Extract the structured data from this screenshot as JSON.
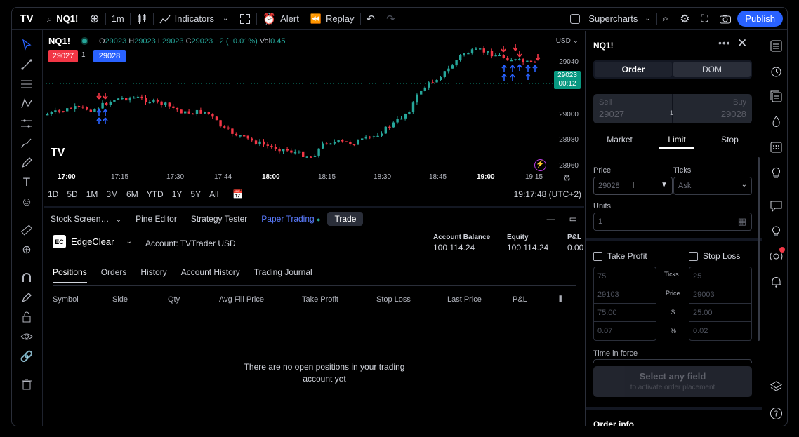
{
  "topbar": {
    "logo": "TV",
    "symbol": "NQ1!",
    "interval": "1m",
    "indicators_label": "Indicators",
    "alert_label": "Alert",
    "replay_label": "Replay",
    "supercharts_label": "Supercharts",
    "publish_label": "Publish"
  },
  "chart": {
    "symbol": "NQ1!",
    "ohlc": {
      "o_label": "O",
      "o": "29023",
      "h_label": "H",
      "h": "29023",
      "l_label": "L",
      "l": "29023",
      "c_label": "C",
      "c": "29023",
      "change": "−2 (−0.01%)",
      "vol_label": "Vol",
      "vol": "0.45"
    },
    "sell_price": "29027",
    "qty": "1",
    "buy_price": "29028",
    "currency": "USD",
    "price_labels": [
      "29040",
      "29000",
      "28980",
      "28960"
    ],
    "last_price": "29023",
    "countdown": "00:12",
    "time_labels": [
      "17:00",
      "17:15",
      "17:30",
      "17:44",
      "18:00",
      "18:15",
      "18:30",
      "18:45",
      "19:00",
      "19:15"
    ],
    "bold_times": [
      "17:00",
      "18:00",
      "19:00"
    ],
    "watermark": "TV",
    "colors": {
      "up": "#26a69a",
      "down": "#f23645",
      "buy_arrow": "#2962ff",
      "sell_arrow": "#f23645"
    }
  },
  "range": {
    "items": [
      "1D",
      "5D",
      "1M",
      "3M",
      "6M",
      "YTD",
      "1Y",
      "5Y",
      "All"
    ],
    "clock": "19:17:48 (UTC+2)"
  },
  "bottom": {
    "tabs": [
      "Stock Screen…",
      "Pine Editor",
      "Strategy Tester",
      "Paper Trading",
      "Trade"
    ],
    "broker": "EdgeClear",
    "broker_logo": "EC",
    "account": "Account: TVTrader USD",
    "balance_label": "Account Balance",
    "balance": "100 114.24",
    "equity_label": "Equity",
    "equity": "100 114.24",
    "pnl_label": "P&L",
    "pnl": "0.00",
    "position_tabs": [
      "Positions",
      "Orders",
      "History",
      "Account History",
      "Trading Journal"
    ],
    "columns": [
      "Symbol",
      "Side",
      "Qty",
      "Avg Fill Price",
      "Take Profit",
      "Stop Loss",
      "Last Price",
      "P&L"
    ],
    "empty_line1": "There are no open positions in your trading",
    "empty_line2": "account yet"
  },
  "order": {
    "title": "NQ1!",
    "tab_order": "Order",
    "tab_dom": "DOM",
    "sell_label": "Sell",
    "sell_price": "29027",
    "buy_label": "Buy",
    "buy_price": "29028",
    "qty_mid": "1",
    "types": [
      "Market",
      "Limit",
      "Stop"
    ],
    "price_label": "Price",
    "price_value": "29028",
    "ticks_label": "Ticks",
    "ticks_value": "Ask",
    "units_label": "Units",
    "units_value": "1",
    "take_profit_label": "Take Profit",
    "stop_loss_label": "Stop Loss",
    "tp_values": [
      "75",
      "29103",
      "75.00",
      "0.07"
    ],
    "sl_values": [
      "25",
      "29003",
      "25.00",
      "0.02"
    ],
    "mid_labels": [
      "Ticks",
      "Price",
      "$",
      "%"
    ],
    "time_in_force_label": "Time in force",
    "select_main": "Select any field",
    "select_sub": "to activate order placement",
    "order_info": "Order info"
  }
}
